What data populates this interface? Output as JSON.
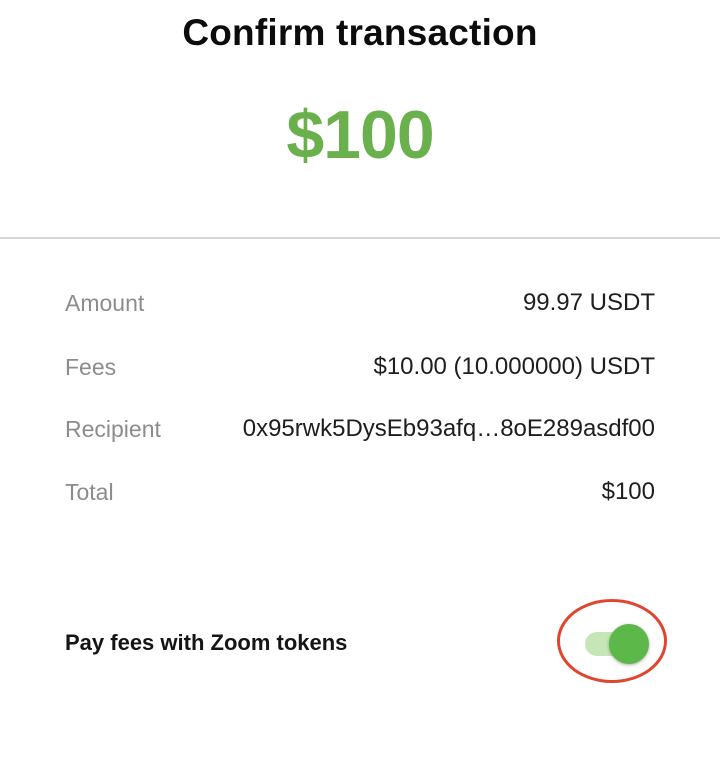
{
  "header": {
    "title": "Confirm transaction",
    "amount": "$100"
  },
  "details": {
    "amount": {
      "label": "Amount",
      "value": "99.97 USDT"
    },
    "fees": {
      "label": "Fees",
      "value": "$10.00 (10.000000)  USDT"
    },
    "recipient": {
      "label": "Recipient",
      "value": "0x95rwk5DysEb93afq…8oE289asdf00"
    },
    "total": {
      "label": "Total",
      "value": "$100"
    }
  },
  "pay_with_tokens": {
    "label": "Pay fees with Zoom tokens",
    "enabled": true
  },
  "colors": {
    "accent_green": "#6ab04c",
    "toggle_on": "#5cb848",
    "toggle_track_on": "#c6e6b8",
    "annotation_red": "#e0452e"
  }
}
